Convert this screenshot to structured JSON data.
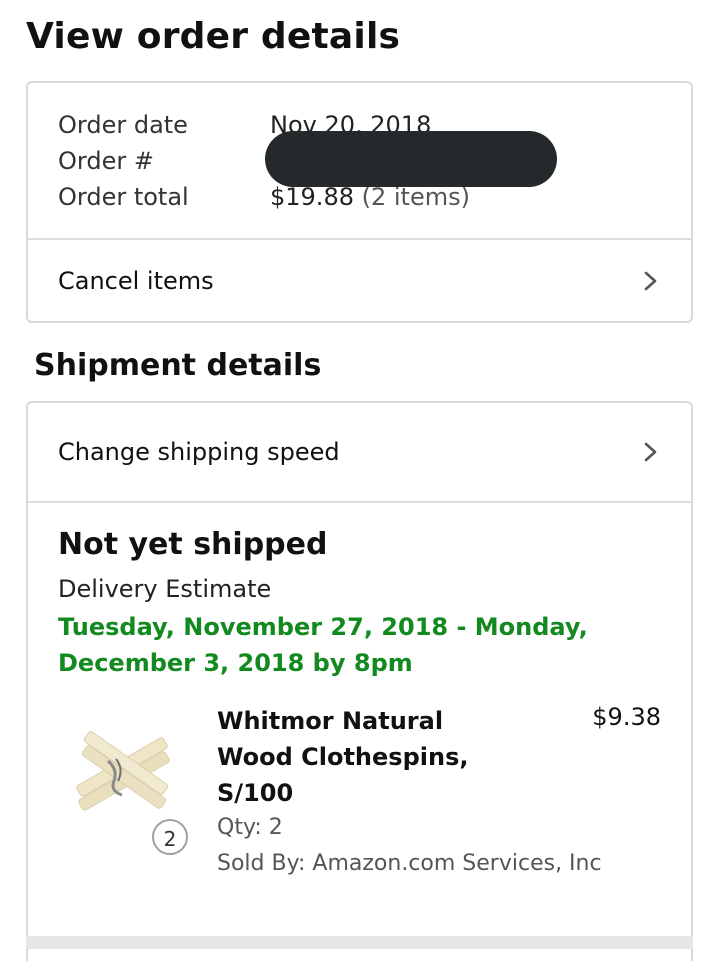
{
  "page": {
    "title": "View order details"
  },
  "order": {
    "date_label": "Order date",
    "date_value": "Nov 20, 2018",
    "number_label": "Order #",
    "total_label": "Order total",
    "total_value": "$19.88",
    "total_items": "(2 items)",
    "cancel_label": "Cancel items"
  },
  "shipment": {
    "section_title": "Shipment details",
    "change_speed_label": "Change shipping speed",
    "status": "Not yet shipped",
    "delivery_label": "Delivery Estimate",
    "delivery_estimate": "Tuesday, November 27, 2018 - Monday, December 3, 2018 by 8pm",
    "item": {
      "title": "Whitmor Natural Wood Clothespins, S/100",
      "price": "$9.38",
      "qty": "Qty: 2",
      "qty_badge": "2",
      "sold_by": "Sold By: Amazon.com Services, Inc",
      "icon": "clothespin-product-image"
    }
  },
  "colors": {
    "accent_green": "#138a1f",
    "border": "#d9d9d9",
    "redaction": "#24292b"
  }
}
